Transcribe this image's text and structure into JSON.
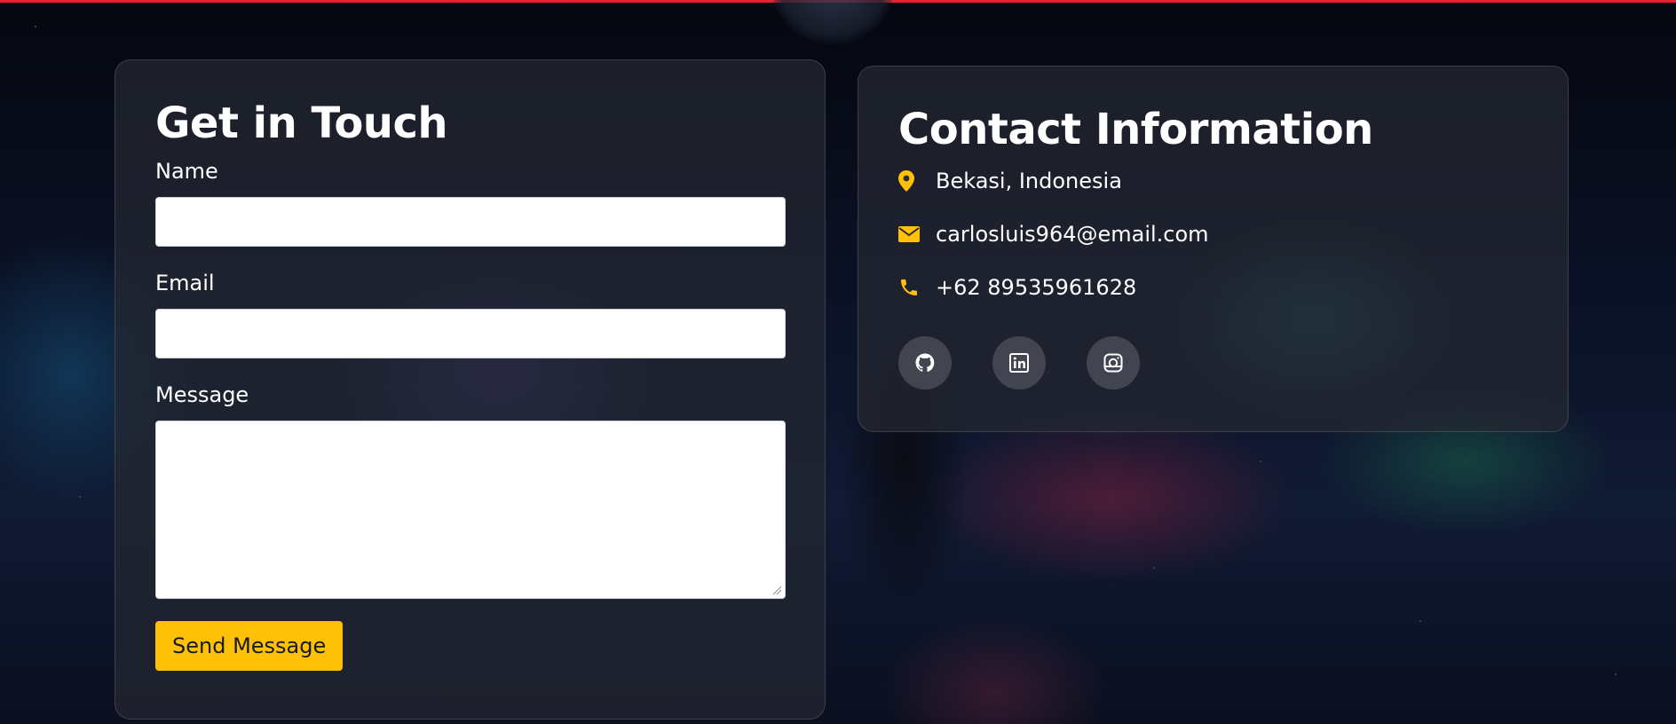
{
  "form": {
    "title": "Get in Touch",
    "name_label": "Name",
    "name_value": "",
    "email_label": "Email",
    "email_value": "",
    "message_label": "Message",
    "message_value": "",
    "submit_label": "Send Message"
  },
  "contact": {
    "title": "Contact Information",
    "items": [
      {
        "icon": "map-pin-icon",
        "text": "Bekasi, Indonesia"
      },
      {
        "icon": "envelope-icon",
        "text": "carlosluis964@email.com"
      },
      {
        "icon": "phone-icon",
        "text": "+62 89535961628"
      }
    ],
    "socials": [
      {
        "icon": "github-icon"
      },
      {
        "icon": "linkedin-icon"
      },
      {
        "icon": "instagram-icon"
      }
    ]
  },
  "colors": {
    "accent": "#ffc107",
    "top_line": "#e02436",
    "card_bg": "rgba(38,40,50,0.72)"
  }
}
